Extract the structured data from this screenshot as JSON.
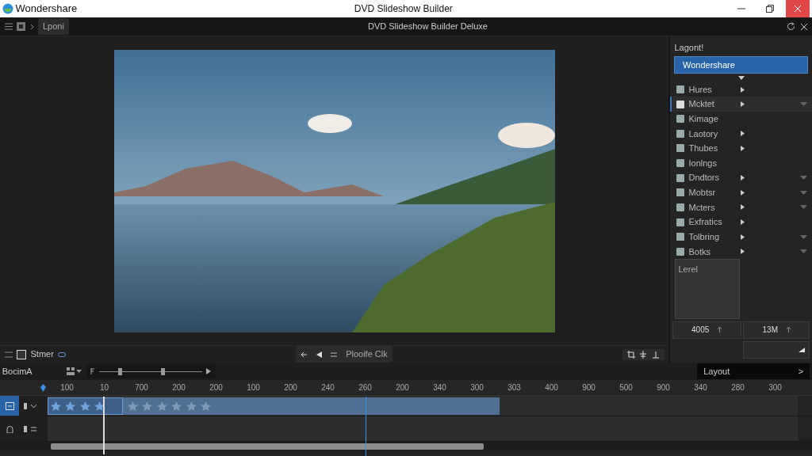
{
  "titlebar": {
    "brand": "Wondershare",
    "title": "DVD Slideshow Builder"
  },
  "toolbar": {
    "label": "Lponi",
    "title": "DVD Slideshow Builder Deluxe"
  },
  "preview_controls": {
    "left_label": "Stmer",
    "center_label": "Plooife Clk"
  },
  "side_panel": {
    "heading": "Lagont!",
    "selected_field": "Wondershare",
    "items": [
      {
        "label": "Hures",
        "arrow": true,
        "dropdown": false,
        "selected": false
      },
      {
        "label": "Mcktet",
        "arrow": true,
        "dropdown": true,
        "selected": true
      },
      {
        "label": "Kimage",
        "arrow": false,
        "dropdown": false,
        "selected": false
      },
      {
        "label": "Laotory",
        "arrow": true,
        "dropdown": false,
        "selected": false
      },
      {
        "label": "Thubes",
        "arrow": true,
        "dropdown": false,
        "selected": false
      },
      {
        "label": "Ionlngs",
        "arrow": false,
        "dropdown": false,
        "selected": false
      },
      {
        "label": "Dndtors",
        "arrow": true,
        "dropdown": true,
        "selected": false
      },
      {
        "label": "Mobtsr",
        "arrow": true,
        "dropdown": true,
        "selected": false
      },
      {
        "label": "Mcters",
        "arrow": true,
        "dropdown": true,
        "selected": false
      },
      {
        "label": "Exfratics",
        "arrow": true,
        "dropdown": false,
        "selected": false
      },
      {
        "label": "Tolbring",
        "arrow": true,
        "dropdown": true,
        "selected": false
      },
      {
        "label": "Botks",
        "arrow": true,
        "dropdown": true,
        "selected": false
      }
    ]
  },
  "properties": {
    "box_label": "Lerel",
    "field_1": "4005",
    "field_2": "13M"
  },
  "timeline": {
    "track_label": "BocimA",
    "layout_field": "Layout",
    "layout_arrow": ">",
    "zoom_thumbs": [
      {
        "level": 0.2
      },
      {
        "level": 0.62
      }
    ],
    "ruler": [
      "100",
      "10",
      "700",
      "200",
      "200",
      "100",
      "200",
      "240",
      "260",
      "200",
      "340",
      "300",
      "303",
      "400",
      "900",
      "500",
      "900",
      "340",
      "280",
      "300"
    ],
    "tracks": [
      {
        "selected": true,
        "has_clip": true
      },
      {
        "selected": false,
        "has_clip": false
      }
    ]
  }
}
